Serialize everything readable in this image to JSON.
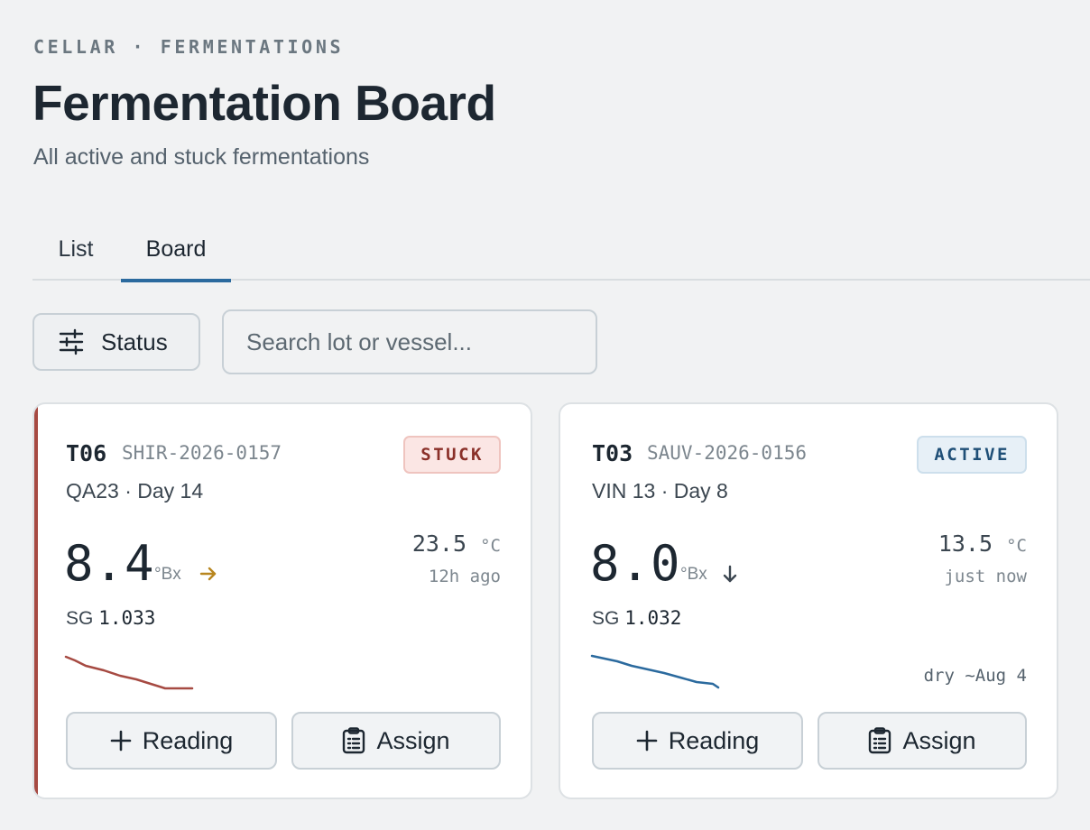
{
  "header": {
    "eyebrow": "CELLAR · FERMENTATIONS",
    "title": "Fermentation Board",
    "subtitle": "All active and stuck fermentations"
  },
  "tabs": [
    {
      "label": "List",
      "active": false
    },
    {
      "label": "Board",
      "active": true
    }
  ],
  "toolbar": {
    "filter_label": "Status",
    "filter_icon": "sliders-icon",
    "search_placeholder": "Search lot or vessel...",
    "search_value": ""
  },
  "cards": [
    {
      "vessel": "T06",
      "lot": "SHIR-2026-0157",
      "status": "STUCK",
      "status_color": "#8a3029",
      "yeast_day": "QA23 · Day 14",
      "brix": "8.4",
      "brix_unit": "°Bx",
      "trend_icon": "arrow-right-icon",
      "trend_color": "#b8861f",
      "temp": "23.5",
      "temp_unit": "°C",
      "reading_age": "12h ago",
      "sg_label": "SG",
      "sg_value": "1.033",
      "spark_color": "#a64a42",
      "eta": "",
      "reading_label": "Reading",
      "assign_label": "Assign"
    },
    {
      "vessel": "T03",
      "lot": "SAUV-2026-0156",
      "status": "ACTIVE",
      "status_color": "#1f4f77",
      "yeast_day": "VIN 13 · Day 8",
      "brix": "8.0",
      "brix_unit": "°Bx",
      "trend_icon": "arrow-down-icon",
      "trend_color": "#3b4650",
      "temp": "13.5",
      "temp_unit": "°C",
      "reading_age": "just now",
      "sg_label": "SG",
      "sg_value": "1.032",
      "spark_color": "#2b6a9e",
      "eta": "dry ~Aug 4",
      "reading_label": "Reading",
      "assign_label": "Assign"
    }
  ]
}
